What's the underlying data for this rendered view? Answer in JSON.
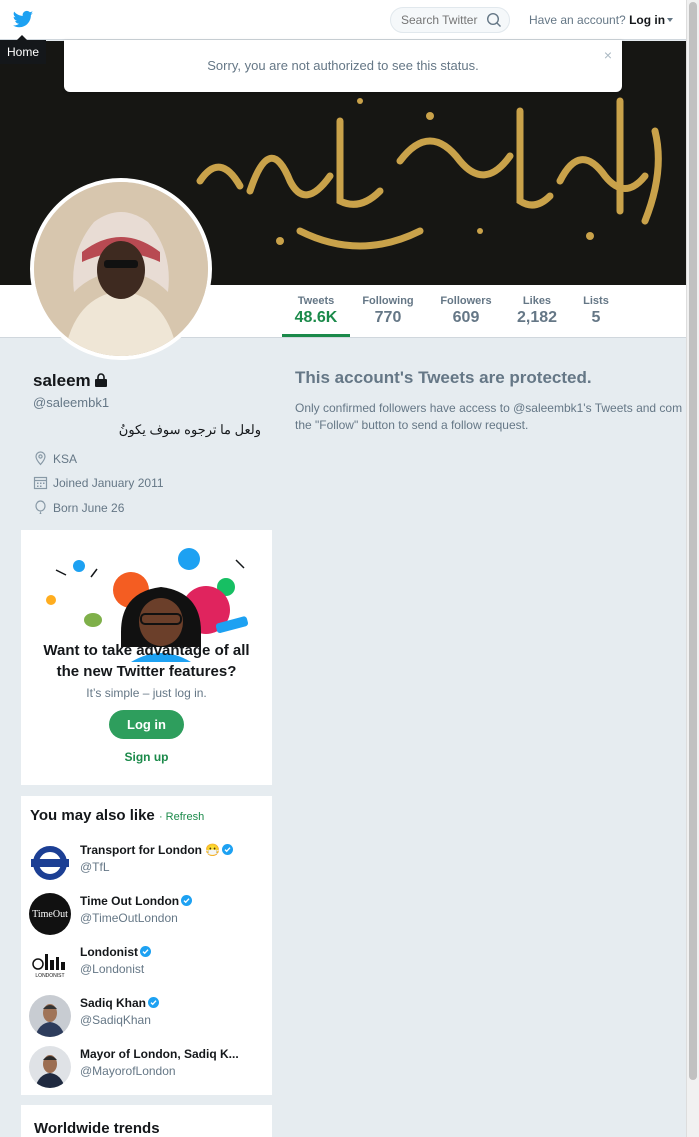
{
  "nav": {
    "home_label": "Home",
    "search_placeholder": "Search Twitter",
    "have_account": "Have an account?",
    "login": "Log in"
  },
  "alert": {
    "message": "Sorry, you are not authorized to see this status.",
    "close": "×"
  },
  "stats": [
    {
      "label": "Tweets",
      "value": "48.6K"
    },
    {
      "label": "Following",
      "value": "770"
    },
    {
      "label": "Followers",
      "value": "609"
    },
    {
      "label": "Likes",
      "value": "2,182"
    },
    {
      "label": "Lists",
      "value": "5"
    }
  ],
  "profile": {
    "name": "saleem",
    "handle": "@saleembk1",
    "bio": "ولعل ما ترجوه سوف يكونُ",
    "location": "KSA",
    "joined": "Joined January 2011",
    "born": "Born June 26"
  },
  "protected": {
    "title": "This account's Tweets are protected.",
    "text_line1": "Only confirmed followers have access to @saleembk1's Tweets and com",
    "text_line2": "the \"Follow\" button to send a follow request."
  },
  "promo": {
    "heading": "Want to take advantage of all the new Twitter features?",
    "sub": "It’s simple – just log in.",
    "login": "Log in",
    "signup": "Sign up"
  },
  "wtf": {
    "title": "You may also like",
    "refresh": "· Refresh",
    "accounts": [
      {
        "name": "Transport for London",
        "emoji": "😷",
        "handle": "@TfL"
      },
      {
        "name": "Time Out London",
        "handle": "@TimeOutLondon"
      },
      {
        "name": "Londonist",
        "handle": "@Londonist"
      },
      {
        "name": "Sadiq Khan",
        "handle": "@SadiqKhan"
      },
      {
        "name": "Mayor of London, Sadiq K...",
        "handle": "@MayorofLondon"
      }
    ]
  },
  "trends": {
    "title": "Worldwide trends"
  },
  "colors": {
    "accent": "#1b8a4a",
    "button": "#2e9e5d",
    "background": "#e6ecf0"
  }
}
